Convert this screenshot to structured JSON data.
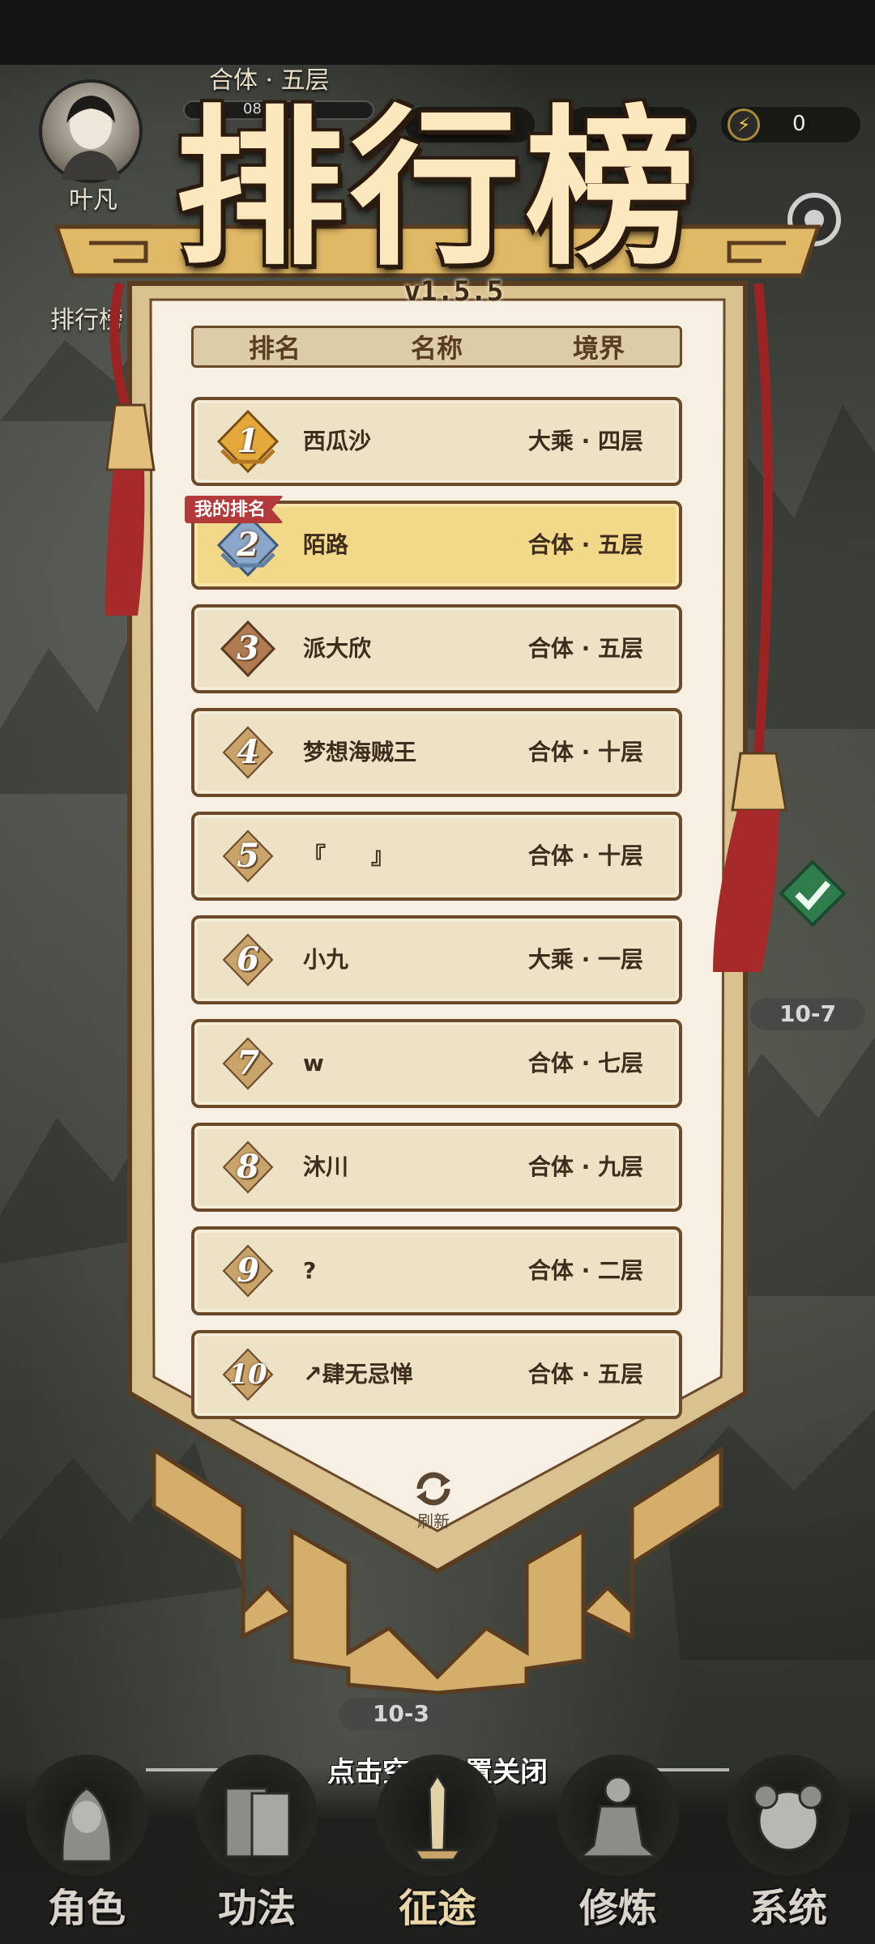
{
  "hud": {
    "player_name": "叶凡",
    "realm": "合体 · 五层",
    "exp_text": "080",
    "energy_value": "0",
    "side_button_label": "排行榜"
  },
  "leaderboard": {
    "title": "排行榜",
    "version": "v1.5.5",
    "headers": {
      "rank": "排名",
      "name": "名称",
      "realm": "境界"
    },
    "my_rank_tag": "我的排名",
    "refresh_label": "刷新",
    "entries": [
      {
        "rank": "1",
        "name": "西瓜沙",
        "realm": "大乘 · 四层"
      },
      {
        "rank": "2",
        "name": "陌路",
        "realm": "合体 · 五层"
      },
      {
        "rank": "3",
        "name": "派大欣",
        "realm": "合体 · 五层"
      },
      {
        "rank": "4",
        "name": "梦想海贼王",
        "realm": "合体 · 十层"
      },
      {
        "rank": "5",
        "name": "『　　』",
        "realm": "合体 · 十层"
      },
      {
        "rank": "6",
        "name": "小九",
        "realm": "大乘 · 一层"
      },
      {
        "rank": "7",
        "name": "w",
        "realm": "合体 · 七层"
      },
      {
        "rank": "8",
        "name": "沐川",
        "realm": "合体 · 九层"
      },
      {
        "rank": "9",
        "name": "?",
        "realm": "合体 · 二层"
      },
      {
        "rank": "10",
        "name": "↗肆无忌惮",
        "realm": "合体 · 五层"
      }
    ],
    "colors": {
      "gold": "#e4a93a",
      "silver": "#8aa6c8",
      "bronze": "#b07a52",
      "other": "#c9a46a",
      "my_row": "#f2d98a",
      "tag": "#b33a3a"
    }
  },
  "map": {
    "stage_right": "10-7",
    "stage_bottom": "10-3"
  },
  "close_hint": "点击空白位置关闭",
  "nav": {
    "items": [
      {
        "label": "角色",
        "icon": "character-icon"
      },
      {
        "label": "功法",
        "icon": "technique-book-icon"
      },
      {
        "label": "征途",
        "icon": "journey-sword-icon"
      },
      {
        "label": "修炼",
        "icon": "cultivation-meditation-icon"
      },
      {
        "label": "系统",
        "icon": "system-avatar-icon"
      }
    ],
    "active": "征途"
  }
}
